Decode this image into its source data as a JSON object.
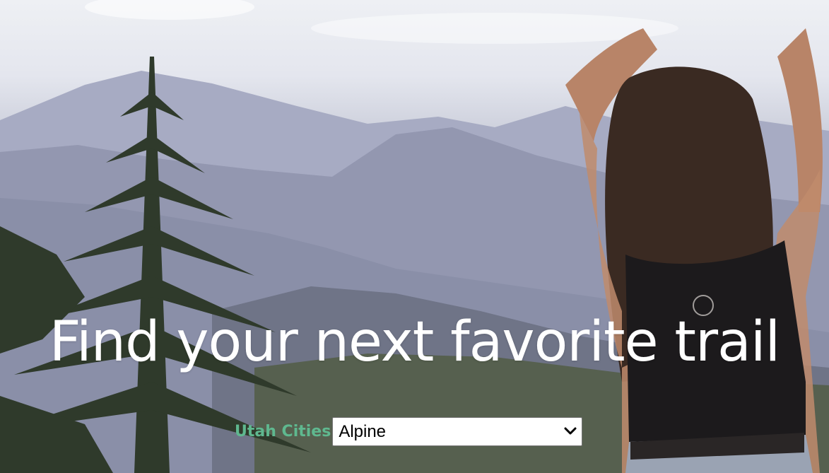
{
  "hero": {
    "background_image": "mountain-trail-hiker-photo",
    "headline": "Find your next favorite trail"
  },
  "city_picker": {
    "label": "Utah Cities",
    "selected_value": "Alpine",
    "label_color": "#5fb88f",
    "dropdown_icon": "chevron-down-icon"
  }
}
